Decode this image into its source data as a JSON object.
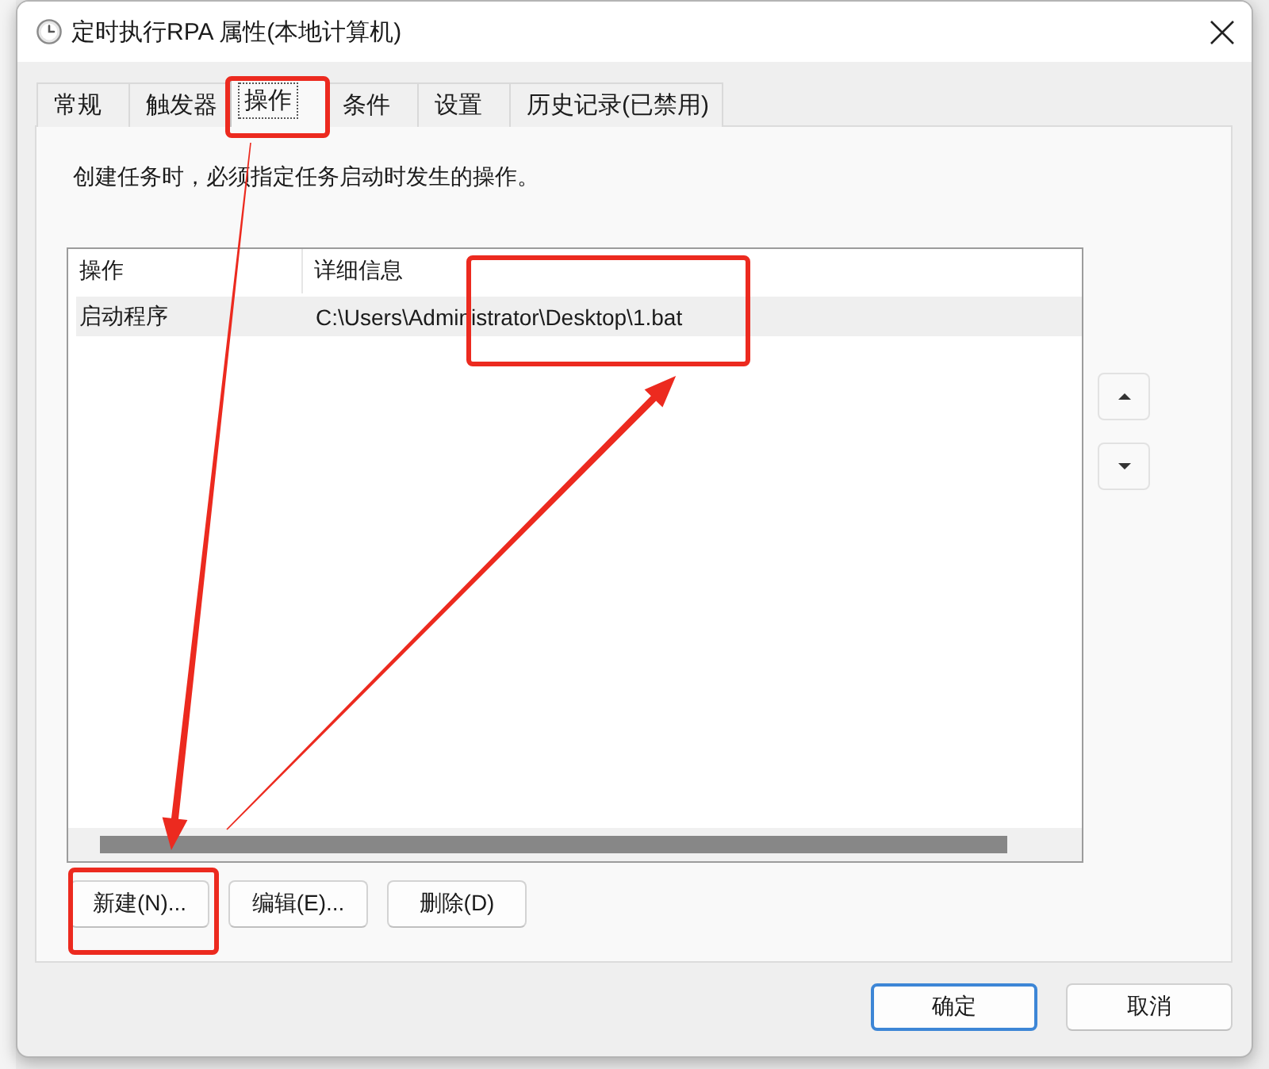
{
  "window": {
    "title": "定时执行RPA 属性(本地计算机)"
  },
  "tabs": [
    {
      "label": "常规",
      "selected": false,
      "highlighted": false
    },
    {
      "label": "触发器",
      "selected": false,
      "highlighted": false
    },
    {
      "label": "操作",
      "selected": true,
      "highlighted": true
    },
    {
      "label": "条件",
      "selected": false,
      "highlighted": false
    },
    {
      "label": "设置",
      "selected": false,
      "highlighted": false
    },
    {
      "label": "历史记录(已禁用)",
      "selected": false,
      "highlighted": false
    }
  ],
  "description": "创建任务时，必须指定任务启动时发生的操作。",
  "actions_table": {
    "columns": [
      "操作",
      "详细信息"
    ],
    "rows": [
      {
        "cells": [
          "启动程序",
          "C:\\Users\\Administrator\\Desktop\\1.bat"
        ],
        "selected": true,
        "highlighted": true
      }
    ]
  },
  "list_buttons": [
    {
      "label": "新建(N)...",
      "highlighted": true
    },
    {
      "label": "编辑(E)...",
      "highlighted": false
    },
    {
      "label": "删除(D)",
      "highlighted": false
    }
  ],
  "dialog_buttons": [
    {
      "label": "确定",
      "default": true
    },
    {
      "label": "取消",
      "default": false
    }
  ]
}
